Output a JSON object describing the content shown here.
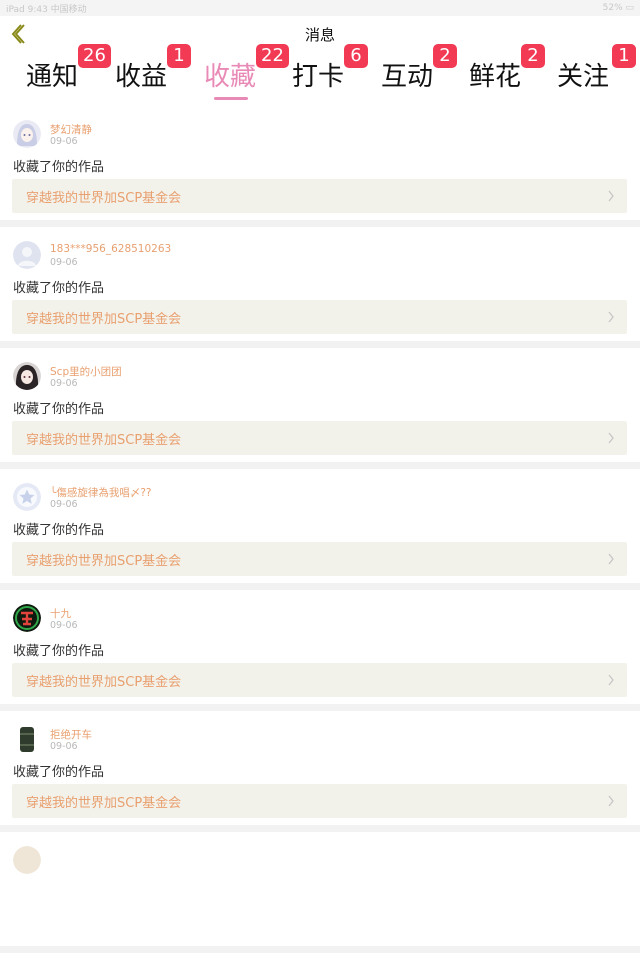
{
  "statusbar": {
    "left": "iPad 9:43 中国移动",
    "right": "52% ▭"
  },
  "header": {
    "title": "消息",
    "back_icon": "chevron-left-icon"
  },
  "tabs": [
    {
      "label": "通知",
      "badge": "26",
      "active": false
    },
    {
      "label": "收益",
      "badge": "1",
      "active": false
    },
    {
      "label": "收藏",
      "badge": "22",
      "active": true
    },
    {
      "label": "打卡",
      "badge": "6",
      "active": false
    },
    {
      "label": "互动",
      "badge": "2",
      "active": false
    },
    {
      "label": "鲜花",
      "badge": "2",
      "active": false
    },
    {
      "label": "关注",
      "badge": "1",
      "active": false
    }
  ],
  "colors": {
    "accent": "#e98ab6",
    "badge": "#f23a55",
    "link": "#e8a070",
    "link_bg": "#f3f2ea"
  },
  "notifications": [
    {
      "user": "梦幻清静",
      "date": "09-06",
      "action": "收藏了你的作品",
      "work": "穿越我的世界加SCP基金会",
      "avatar_icon": "anime-girl-avatar"
    },
    {
      "user": "183***956_628510263",
      "date": "09-06",
      "action": "收藏了你的作品",
      "work": "穿越我的世界加SCP基金会",
      "avatar_icon": "default-user-avatar"
    },
    {
      "user": "Scp里的小团团",
      "date": "09-06",
      "action": "收藏了你的作品",
      "work": "穿越我的世界加SCP基金会",
      "avatar_icon": "dark-hair-avatar"
    },
    {
      "user": "╰傷感旋律為我唱〆??",
      "date": "09-06",
      "action": "收藏了你的作品",
      "work": "穿越我的世界加SCP基金会",
      "avatar_icon": "star-avatar"
    },
    {
      "user": "十九",
      "date": "09-06",
      "action": "收藏了你的作品",
      "work": "穿越我的世界加SCP基金会",
      "avatar_icon": "green-emblem-avatar"
    },
    {
      "user": "拒绝开车",
      "date": "09-06",
      "action": "收藏了你的作品",
      "work": "穿越我的世界加SCP基金会",
      "avatar_icon": "barrel-avatar"
    }
  ]
}
